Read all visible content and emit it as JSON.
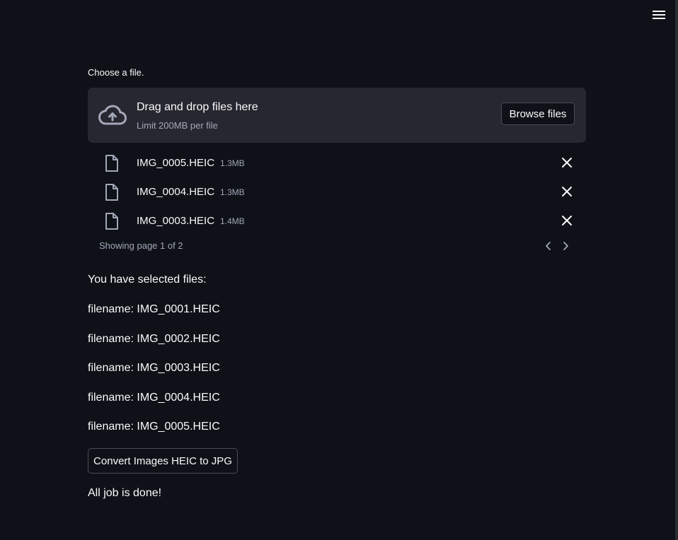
{
  "menu": {
    "icon": "hamburger-menu-icon"
  },
  "uploader": {
    "label": "Choose a file.",
    "drop_text": "Drag and drop files here",
    "limit_text": "Limit 200MB per file",
    "browse_label": "Browse files",
    "upload_icon": "cloud-upload-icon",
    "files": [
      {
        "name": "IMG_0005.HEIC",
        "size": "1.3MB",
        "icon": "file-icon",
        "remove_icon": "close-icon"
      },
      {
        "name": "IMG_0004.HEIC",
        "size": "1.3MB",
        "icon": "file-icon",
        "remove_icon": "close-icon"
      },
      {
        "name": "IMG_0003.HEIC",
        "size": "1.4MB",
        "icon": "file-icon",
        "remove_icon": "close-icon"
      }
    ],
    "pagination": {
      "text": "Showing page 1 of 2",
      "prev_icon": "chevron-left-icon",
      "next_icon": "chevron-right-icon"
    }
  },
  "results": {
    "heading": "You have selected files:",
    "filenames": [
      "filename: IMG_0001.HEIC",
      "filename: IMG_0002.HEIC",
      "filename: IMG_0003.HEIC",
      "filename: IMG_0004.HEIC",
      "filename: IMG_0005.HEIC"
    ],
    "convert_button_label": "Convert Images HEIC to JPG",
    "done_message": "All job is done!"
  },
  "colors": {
    "background": "#0e1117",
    "dropzone": "#262730",
    "text": "#fafafa",
    "muted_text": "#a3a8b8",
    "button_border": "#4a4c55"
  }
}
